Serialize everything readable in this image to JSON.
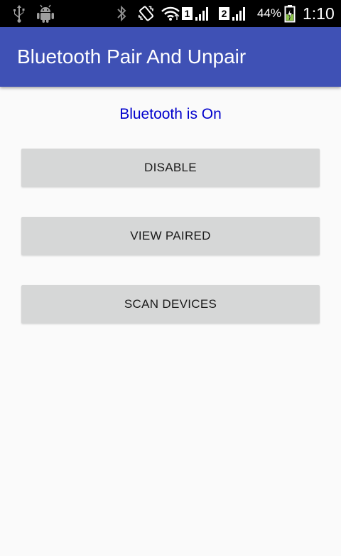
{
  "status_bar": {
    "icons": [
      "usb-icon",
      "android-debug-icon",
      "bluetooth-icon",
      "vibrate-icon",
      "wifi-icon",
      "signal-sim1-icon",
      "signal-sim2-icon",
      "battery-charging-icon"
    ],
    "sim1_label": "1",
    "sim2_label": "2",
    "battery": "44%",
    "time": "1:10"
  },
  "app_bar": {
    "title": "Bluetooth Pair And Unpair",
    "color": "#3f51b5"
  },
  "main": {
    "status": "Bluetooth is On",
    "status_color": "#0000cc",
    "buttons": {
      "disable": "DISABLE",
      "view_paired": "VIEW PAIRED",
      "scan_devices": "SCAN DEVICES"
    }
  }
}
